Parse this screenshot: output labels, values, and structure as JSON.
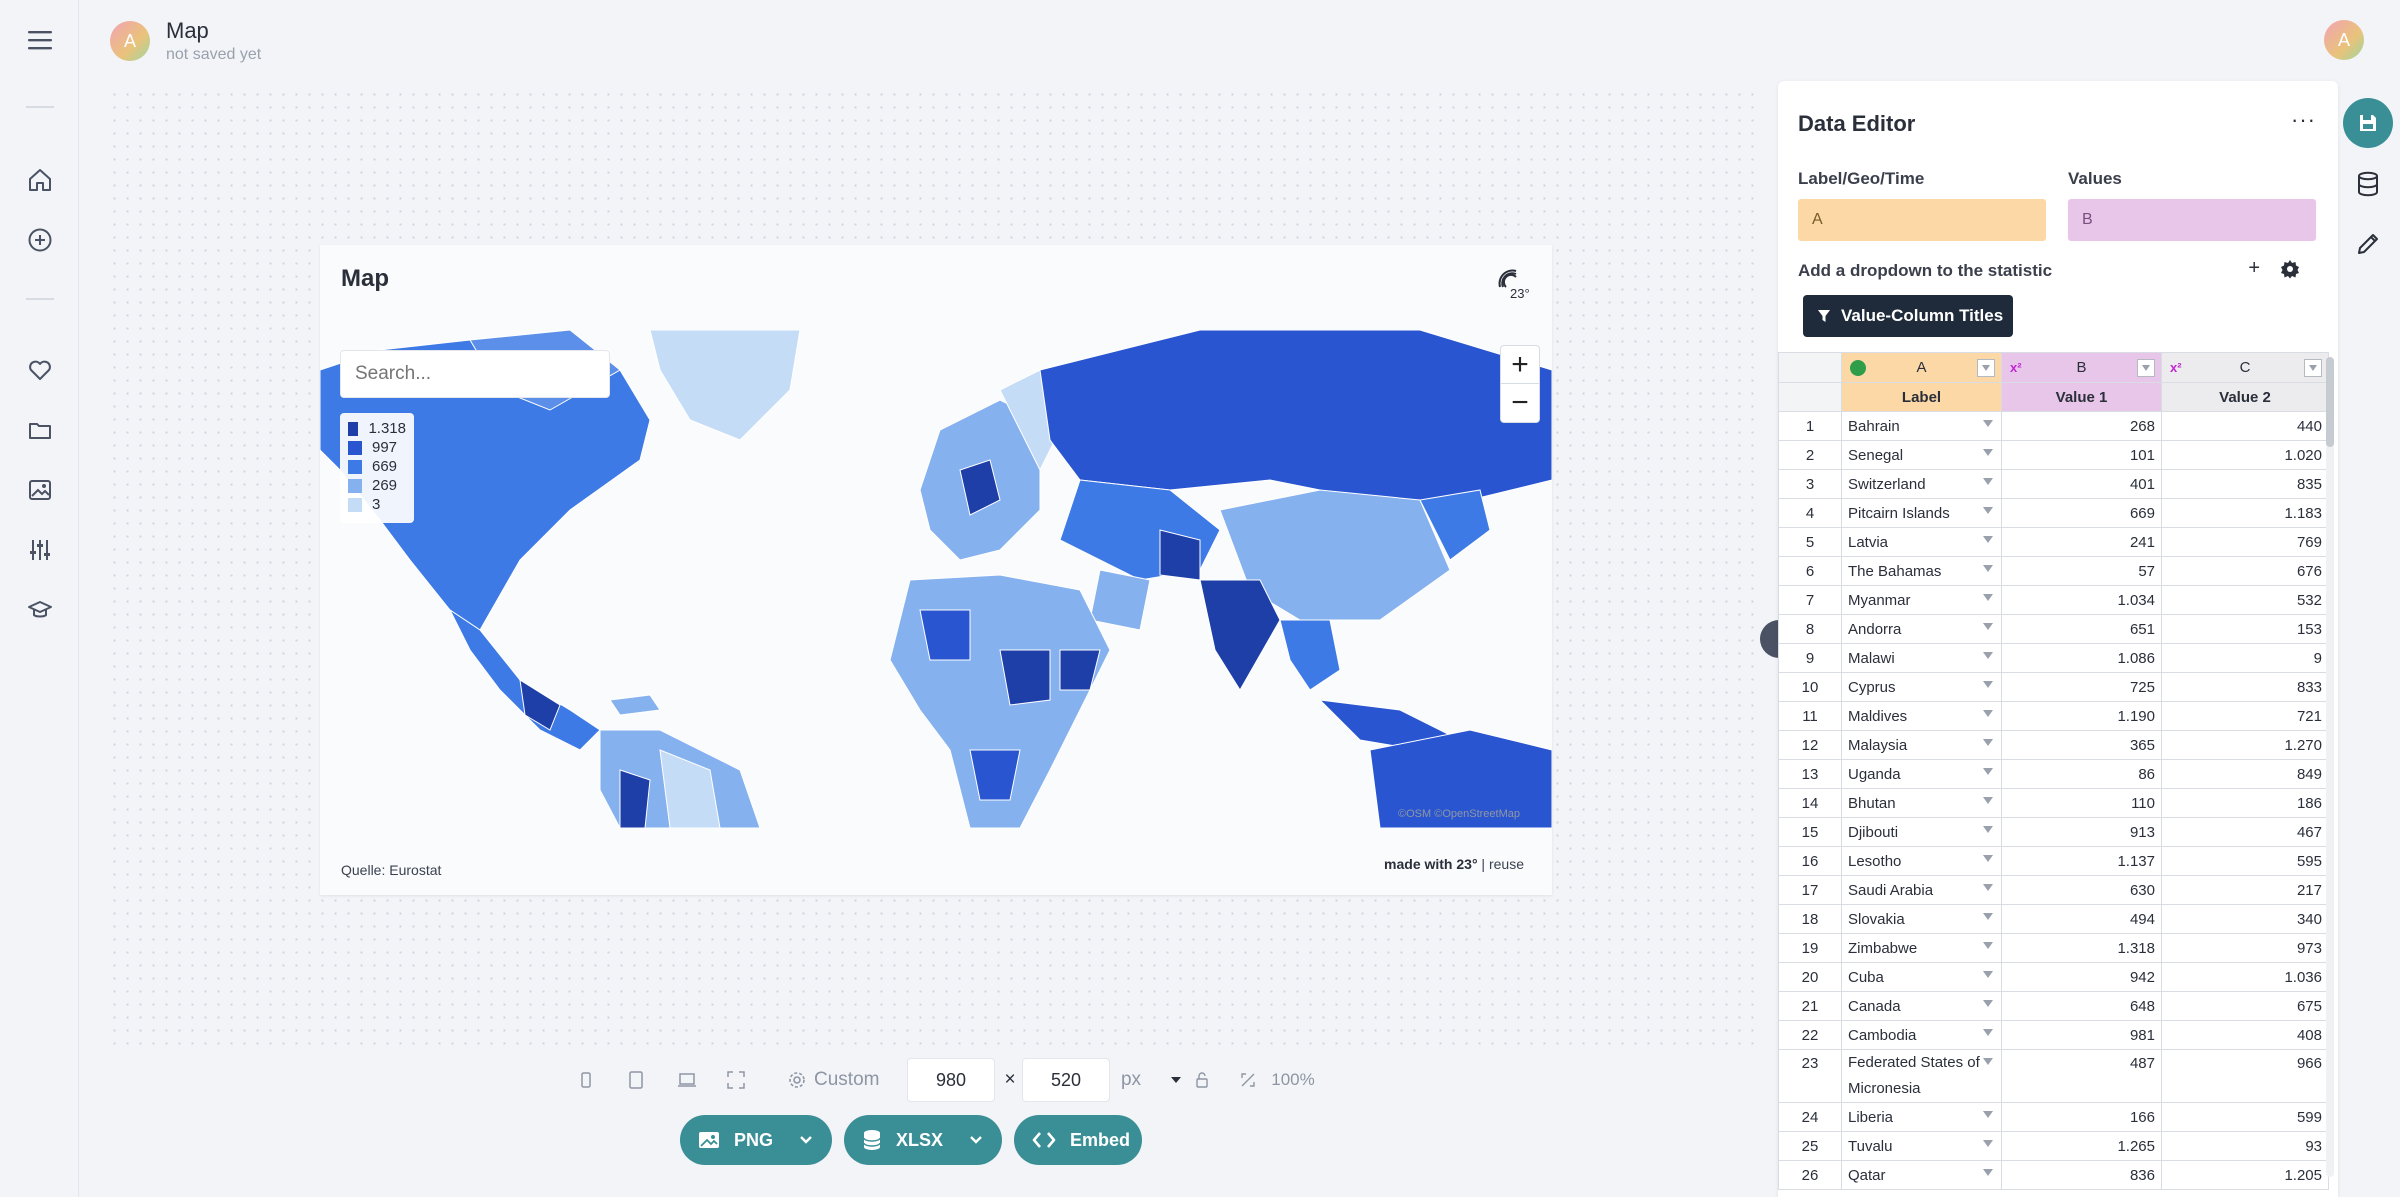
{
  "header": {
    "avatar_letter": "A",
    "title": "Map",
    "subtitle": "not saved yet",
    "user_letter": "A"
  },
  "nav": [
    "menu-icon",
    "home-icon",
    "add-icon",
    "heart-icon",
    "folder-icon",
    "image-icon",
    "sliders-icon",
    "graduation-cap-icon"
  ],
  "map": {
    "title": "Map",
    "search_placeholder": "Search...",
    "legend": [
      {
        "label": "1.318",
        "color": "#1f3fa8"
      },
      {
        "label": "997",
        "color": "#2a55d0"
      },
      {
        "label": "669",
        "color": "#3d7ae6"
      },
      {
        "label": "269",
        "color": "#86b1ef"
      },
      {
        "label": "3",
        "color": "#c5dcf7"
      }
    ],
    "zoom_in": "+",
    "zoom_out": "−",
    "attribution": "©OSM ©OpenStreetMap",
    "source": "Quelle: Eurostat",
    "made_with": "made with 23°",
    "reuse": "reuse"
  },
  "toolbar": {
    "custom_label": "Custom",
    "width": "980",
    "times": "×",
    "height": "520",
    "unit": "px",
    "zoom": "100%",
    "png": "PNG",
    "xlsx": "XLSX",
    "embed": "Embed"
  },
  "editor": {
    "title": "Data Editor",
    "more": "···",
    "label_field_title": "Label/Geo/Time",
    "label_field_value": "A",
    "values_field_title": "Values",
    "values_field_value": "B",
    "dropdown_text": "Add a dropdown to the statistic",
    "plus": "+",
    "vct_button": "Value-Column Titles",
    "col_letters": [
      "A",
      "B",
      "C"
    ],
    "col_names": [
      "Label",
      "Value 1",
      "Value 2"
    ],
    "x2": "x²",
    "rows": [
      [
        "1",
        "Bahrain",
        "268",
        "440"
      ],
      [
        "2",
        "Senegal",
        "101",
        "1.020"
      ],
      [
        "3",
        "Switzerland",
        "401",
        "835"
      ],
      [
        "4",
        "Pitcairn Islands",
        "669",
        "1.183"
      ],
      [
        "5",
        "Latvia",
        "241",
        "769"
      ],
      [
        "6",
        "The Bahamas",
        "57",
        "676"
      ],
      [
        "7",
        "Myanmar",
        "1.034",
        "532"
      ],
      [
        "8",
        "Andorra",
        "651",
        "153"
      ],
      [
        "9",
        "Malawi",
        "1.086",
        "9"
      ],
      [
        "10",
        "Cyprus",
        "725",
        "833"
      ],
      [
        "11",
        "Maldives",
        "1.190",
        "721"
      ],
      [
        "12",
        "Malaysia",
        "365",
        "1.270"
      ],
      [
        "13",
        "Uganda",
        "86",
        "849"
      ],
      [
        "14",
        "Bhutan",
        "110",
        "186"
      ],
      [
        "15",
        "Djibouti",
        "913",
        "467"
      ],
      [
        "16",
        "Lesotho",
        "1.137",
        "595"
      ],
      [
        "17",
        "Saudi Arabia",
        "630",
        "217"
      ],
      [
        "18",
        "Slovakia",
        "494",
        "340"
      ],
      [
        "19",
        "Zimbabwe",
        "1.318",
        "973"
      ],
      [
        "20",
        "Cuba",
        "942",
        "1.036"
      ],
      [
        "21",
        "Canada",
        "648",
        "675"
      ],
      [
        "22",
        "Cambodia",
        "981",
        "408"
      ],
      [
        "23",
        "Federated States of Micronesia",
        "487",
        "966"
      ],
      [
        "24",
        "Liberia",
        "166",
        "599"
      ],
      [
        "25",
        "Tuvalu",
        "1.265",
        "93"
      ],
      [
        "26",
        "Qatar",
        "836",
        "1.205"
      ]
    ]
  },
  "colors": {
    "accent": "#3a8f96",
    "label_col": "#fbd8a6",
    "value_col": "#e8c6ea",
    "dark_button": "#1f2b3a"
  }
}
